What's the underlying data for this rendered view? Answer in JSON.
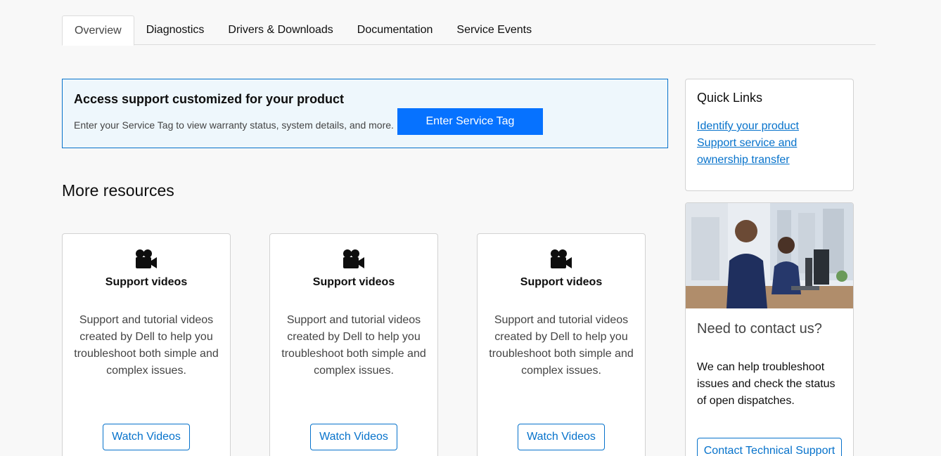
{
  "tabs": [
    {
      "label": "Overview",
      "active": true
    },
    {
      "label": "Diagnostics"
    },
    {
      "label": "Drivers & Downloads"
    },
    {
      "label": "Documentation"
    },
    {
      "label": "Service Events"
    }
  ],
  "banner": {
    "title": "Access support customized for your product",
    "text": "Enter your Service Tag to view warranty status, system details, and more.",
    "button": "Enter Service Tag"
  },
  "more_resources": {
    "title": "More resources",
    "cards": [
      {
        "icon": "video-camera-icon",
        "title": "Support videos",
        "text": "Support and tutorial videos created by Dell to help you troubleshoot both simple and complex issues.",
        "button": "Watch Videos"
      },
      {
        "icon": "video-camera-icon",
        "title": "Support videos",
        "text": "Support and tutorial videos created by Dell to help you troubleshoot both simple and complex issues.",
        "button": "Watch Videos"
      },
      {
        "icon": "video-camera-icon",
        "title": "Support videos",
        "text": "Support and tutorial videos created by Dell to help you troubleshoot both simple and complex issues.",
        "button": "Watch Videos"
      }
    ]
  },
  "quick_links": {
    "title": "Quick Links",
    "links": [
      "Identify your product",
      "Support service and ownership transfer"
    ]
  },
  "contact": {
    "title": "Need to contact us?",
    "text": "We can help troubleshoot issues and check the status of open dispatches.",
    "button": "Contact Technical Support"
  },
  "colors": {
    "accent": "#0672cb",
    "primary_button": "#0672ff",
    "banner_bg": "#eef7fc"
  }
}
